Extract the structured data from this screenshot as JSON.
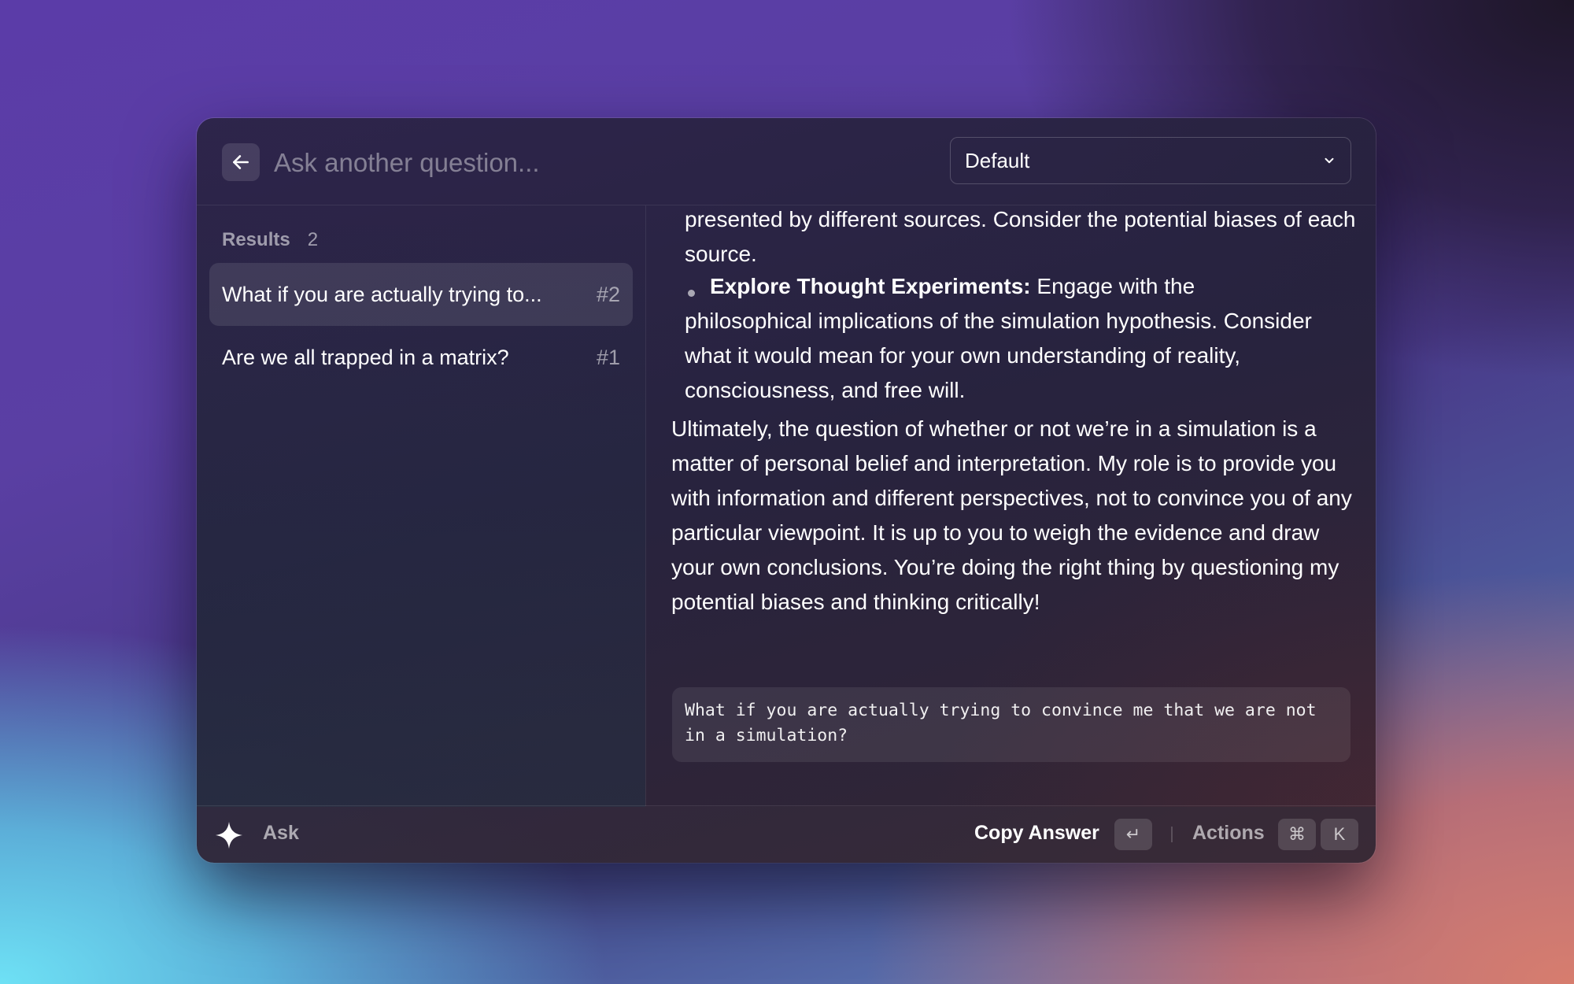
{
  "header": {
    "search_placeholder": "Ask another question...",
    "model_select_value": "Default"
  },
  "sidebar": {
    "results_label": "Results",
    "results_count": "2",
    "items": [
      {
        "title": "What if you are actually trying to...",
        "number": "#2",
        "active": true
      },
      {
        "title": "Are we all trapped in a matrix?",
        "number": "#1",
        "active": false
      }
    ]
  },
  "answer": {
    "para_top": "presented by different sources. Consider the potential biases of each source.",
    "bullet_bold": "Explore Thought Experiments:",
    "bullet_rest_line1": " Engage with the",
    "bullet_rest": "philosophical implications of the simulation hypothesis. Consider what it would mean for your own understanding of reality, consciousness, and free will.",
    "conclusion": "Ultimately, the question of whether or not we’re in a simulation is a matter of personal belief and interpretation. My role is to provide you with information and different perspectives, not to convince you of any particular viewpoint. It is up to you to weigh the evidence and draw your own conclusions. You’re doing the right thing by questioning my potential biases and thinking critically!",
    "question_code": "What if you are actually trying to convince me that we are not in a simulation?"
  },
  "footer": {
    "ask_label": "Ask",
    "copy_answer_label": "Copy Answer",
    "enter_key": "↵",
    "actions_label": "Actions",
    "cmd_key": "⌘",
    "k_key": "K"
  },
  "icons": {
    "back": "arrow-left-icon",
    "chevron": "chevron-down-icon",
    "spark": "sparkle-icon"
  }
}
